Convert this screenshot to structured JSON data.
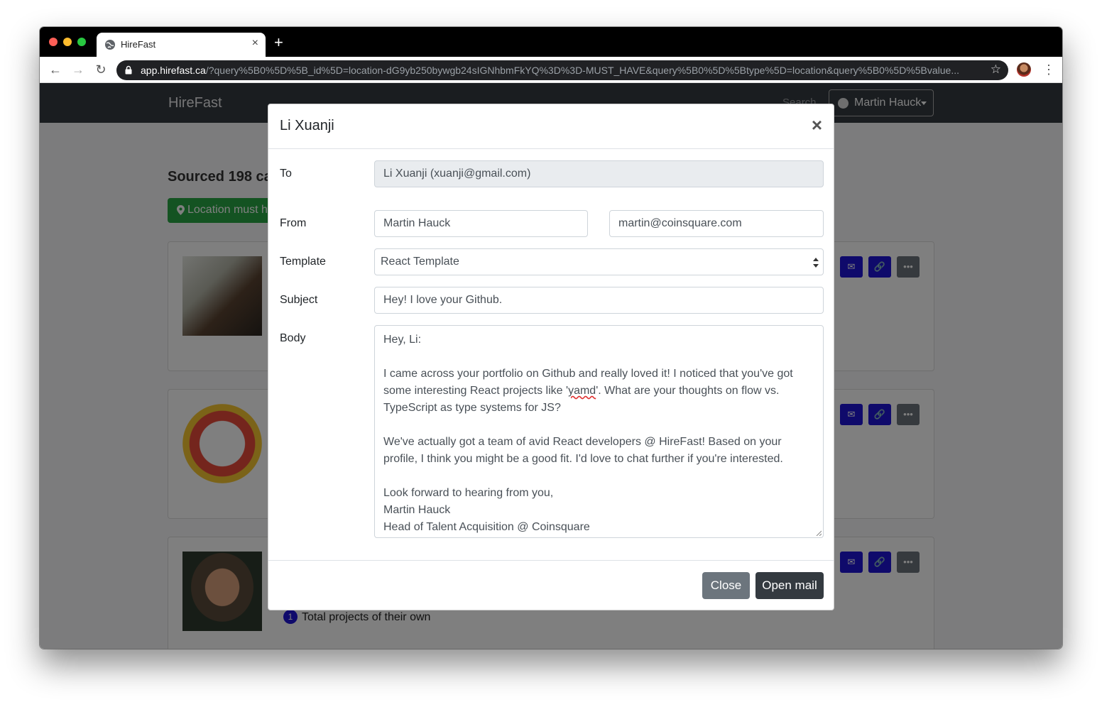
{
  "browser": {
    "tab_title": "HireFast",
    "new_tab": "+",
    "url_host": "app.hirefast.ca",
    "url_rest": "/?query%5B0%5D%5B_id%5D=location-dG9yb250bywgb24sIGNhbmFkYQ%3D%3D-MUST_HAVE&query%5B0%5D%5Btype%5D=location&query%5B0%5D%5Bvalue..."
  },
  "navbar": {
    "brand": "HireFast",
    "search_hint": "Search",
    "user_name": "Martin Hauck"
  },
  "page": {
    "sourced_text": "Sourced 198 ca",
    "location_badge": "Location must h",
    "card3_projects_count": "1",
    "card3_projects_label": "Total projects of their own"
  },
  "modal": {
    "title": "Li Xuanji",
    "close_symbol": "×",
    "labels": {
      "to": "To",
      "from": "From",
      "template": "Template",
      "subject": "Subject",
      "body": "Body"
    },
    "to_value": "Li Xuanji (xuanji@gmail.com)",
    "from_name": "Martin Hauck",
    "from_email": "martin@coinsquare.com",
    "template_value": "React Template",
    "subject_value": "Hey! I love your Github.",
    "body": {
      "greeting": "Hey, Li:",
      "p1_before": "I came across your portfolio on Github and really loved it! I noticed that you've got some interesting React projects like '",
      "p1_misspelled": "yamd",
      "p1_after": "'. What are your thoughts on flow vs. TypeScript as type systems for JS?",
      "p2": "We've actually got a team of avid React developers @ HireFast! Based on your profile, I think you might be a good fit. I'd love to chat further if you're interested.",
      "signoff": "Look forward to hearing from you,",
      "sig_name": "Martin Hauck",
      "sig_title": "Head of Talent Acquisition @ Coinsquare"
    },
    "buttons": {
      "close": "Close",
      "open_mail": "Open mail"
    }
  },
  "colors": {
    "navbar": "#343a40",
    "primary_action": "#1f14d6",
    "success": "#28a745",
    "secondary": "#6c757d"
  }
}
